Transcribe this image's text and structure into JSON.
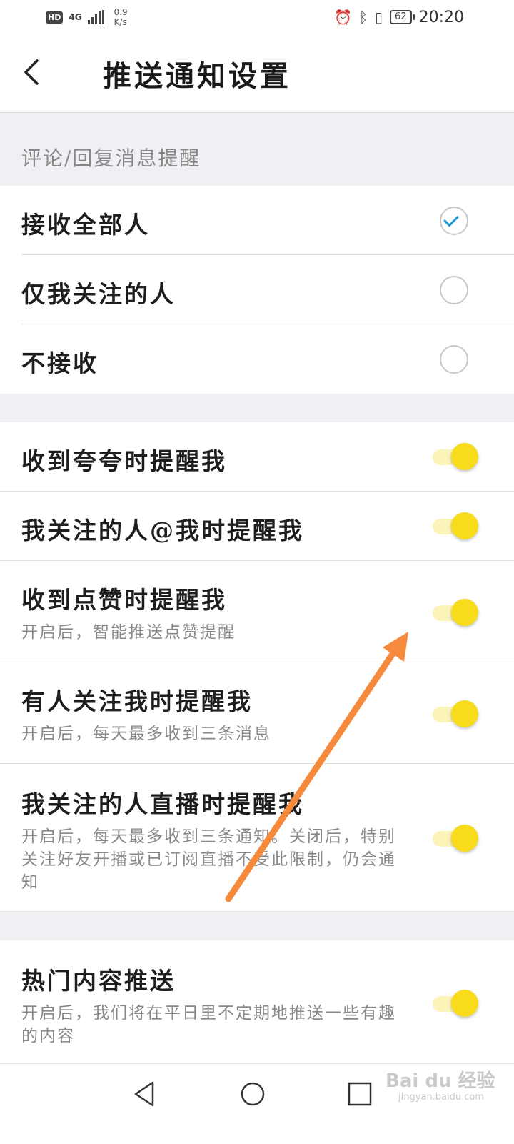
{
  "status_bar": {
    "hd": "HD",
    "network": "4G",
    "speed": "0.9\nK/s",
    "battery": "62",
    "time": "20:20"
  },
  "header": {
    "title": "推送通知设置"
  },
  "comment_section": {
    "label": "评论/回复消息提醒",
    "options": [
      {
        "label": "接收全部人",
        "selected": true
      },
      {
        "label": "仅我关注的人",
        "selected": false
      },
      {
        "label": "不接收",
        "selected": false
      }
    ]
  },
  "toggles": [
    {
      "title": "收到夸夸时提醒我",
      "on": true
    },
    {
      "title": "我关注的人@我时提醒我",
      "on": true
    },
    {
      "title": "收到点赞时提醒我",
      "subtitle": "开启后，智能推送点赞提醒",
      "on": true
    },
    {
      "title": "有人关注我时提醒我",
      "subtitle": "开启后，每天最多收到三条消息",
      "on": true
    },
    {
      "title": "我关注的人直播时提醒我",
      "subtitle": "开启后，每天最多收到三条通知。关闭后，特别关注好友开播或已订阅直播不受此限制，仍会通知",
      "on": true
    }
  ],
  "hot_content": {
    "title": "热门内容推送",
    "subtitle": "开启后，我们将在平日里不定期地推送一些有趣的内容",
    "on": true
  },
  "watermark": {
    "brand": "Bai du 经验",
    "site": "jingyan.baidu.com"
  },
  "colors": {
    "toggle_thumb": "#f8dc1b",
    "toggle_track": "#fbf3b8",
    "check": "#1e9bd7",
    "arrow": "#f58a3c",
    "section_bg": "#eef0f3"
  }
}
